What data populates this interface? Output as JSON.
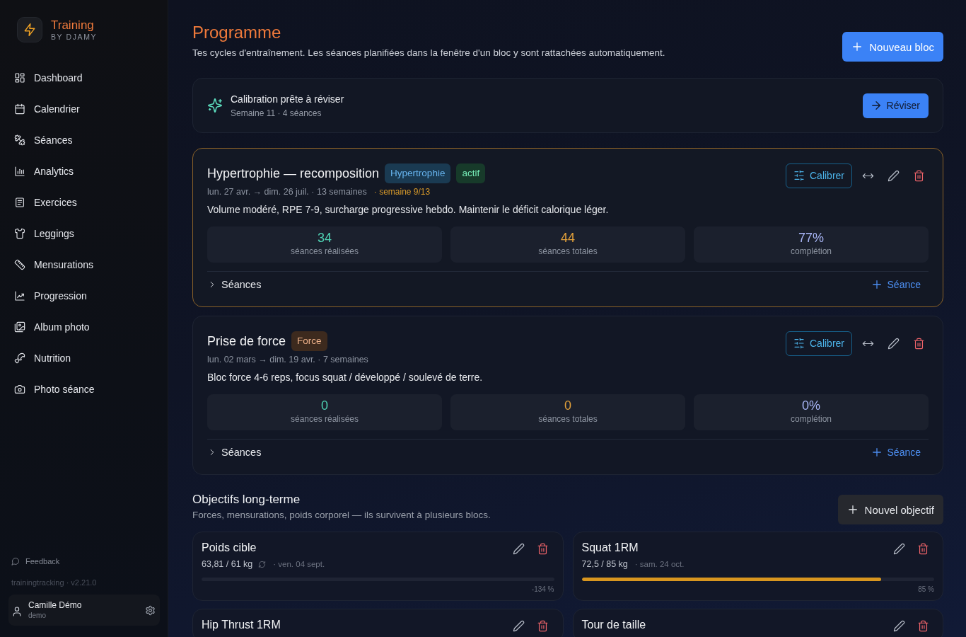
{
  "sidebar": {
    "brand": {
      "name": "Training",
      "tagline": "BY DJAMY"
    },
    "nav": [
      {
        "label": "Dashboard",
        "selected": false
      },
      {
        "label": "Calendrier",
        "selected": false
      },
      {
        "label": "Séances",
        "selected": false
      },
      {
        "label": "Analytics",
        "selected": false
      },
      {
        "label": "Exercices",
        "selected": false
      },
      {
        "label": "Leggings",
        "selected": false
      },
      {
        "label": "Mensurations",
        "selected": false
      },
      {
        "label": "Progression",
        "selected": false
      },
      {
        "label": "Album photo",
        "selected": false
      },
      {
        "label": "Nutrition",
        "selected": false
      },
      {
        "label": "Photo séance",
        "selected": false
      }
    ],
    "feedback": "Feedback",
    "version": "trainingtracking · v2.21.0",
    "user": {
      "name": "Camille Démo",
      "login": "demo"
    }
  },
  "header": {
    "title": "Programme",
    "subtitle": "Tes cycles d'entraînement. Les séances planifiées dans la fenêtre d'un bloc y sont rattachées automatiquement.",
    "new_block_button": "Nouveau bloc"
  },
  "calibration_notice": {
    "title": "Calibration prête à réviser",
    "detail": "Semaine 11 · 4 séances",
    "review_button": "Réviser"
  },
  "blocks": [
    {
      "title": "Hypertrophie — recomposition",
      "active": true,
      "tags": [
        {
          "label": "Hypertrophie",
          "color": "#1a3a52"
        },
        {
          "label": "actif",
          "color": "#173a2a"
        }
      ],
      "dates": "lun. 27 avr. → dim. 26 juil. · 13 semaines",
      "week": "· semaine 9/13",
      "calibrate_button": "Calibrer",
      "description": "Volume modéré, RPE 7-9, surcharge progressive hebdo. Maintenir le déficit calorique léger.",
      "stats": [
        {
          "value": "34",
          "label": "séances réalisées"
        },
        {
          "value": "44",
          "label": "séances totales"
        },
        {
          "value": "77%",
          "label": "complétion"
        }
      ],
      "sessions": {
        "label": "Séances",
        "expanded": false
      },
      "add_session_button": "Séance"
    },
    {
      "title": "Prise de force",
      "active": false,
      "tags": [
        {
          "label": "Force",
          "color": "#3d2a1e"
        }
      ],
      "dates": "lun. 02 mars → dim. 19 avr. · 7 semaines",
      "calibrate_button": "Calibrer",
      "description": "Bloc force 4-6 reps, focus squat / développé / soulevé de terre.",
      "stats": [
        {
          "value": "0",
          "label": "séances réalisées"
        },
        {
          "value": "0",
          "label": "séances totales"
        },
        {
          "value": "0%",
          "label": "complétion"
        }
      ],
      "sessions": {
        "label": "Séances",
        "expanded": false
      },
      "add_session_button": "Séance"
    }
  ],
  "goals": {
    "title": "Objectifs long-terme",
    "subtitle": "Forces, mensurations, poids corporel — ils survivent à plusieurs blocs.",
    "new_goal_button": "Nouvel objectif",
    "items": [
      {
        "title": "Poids cible",
        "progress": "63,81 / 61 kg",
        "auto_sync": true,
        "date": "· ven. 04 sept.",
        "level": 0,
        "percent": "-134 %"
      },
      {
        "title": "Squat 1RM",
        "progress": "72,5 / 85 kg",
        "auto_sync": false,
        "date": "· sam. 24 oct.",
        "level": 0.85,
        "percent": "85 %"
      },
      {
        "title": "Hip Thrust 1RM"
      },
      {
        "title": "Tour de taille"
      }
    ]
  }
}
